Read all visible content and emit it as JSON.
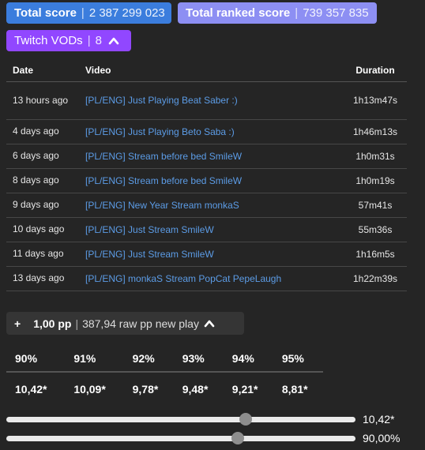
{
  "header": {
    "total_score_label": "Total score",
    "total_score_value": "2 387 299 023",
    "ranked_score_label": "Total ranked score",
    "ranked_score_value": "739 357 835",
    "score_color": "#3b7ddd",
    "ranked_color": "#8d8ff3"
  },
  "vods": {
    "toggle_label": "Twitch VODs",
    "count": "8",
    "accent_color": "#9147ff",
    "icon": "chevron-up-icon",
    "columns": {
      "date": "Date",
      "video": "Video",
      "duration": "Duration"
    },
    "rows": [
      {
        "date": "13 hours ago",
        "title": "[PL/ENG] Just Playing Beat Saber :)",
        "duration": "1h13m47s"
      },
      {
        "date": "4 days ago",
        "title": "[PL/ENG] Just Playing Beto Saba :)",
        "duration": "1h46m13s"
      },
      {
        "date": "6 days ago",
        "title": "[PL/ENG] Stream before bed SmileW",
        "duration": "1h0m31s"
      },
      {
        "date": "8 days ago",
        "title": "[PL/ENG] Stream before bed SmileW",
        "duration": "1h0m19s"
      },
      {
        "date": "9 days ago",
        "title": "[PL/ENG] New Year Stream monkaS",
        "duration": "57m41s"
      },
      {
        "date": "10 days ago",
        "title": "[PL/ENG] Just Stream SmileW",
        "duration": "55m36s"
      },
      {
        "date": "11 days ago",
        "title": "[PL/ENG] Just Stream SmileW",
        "duration": "1h16m5s"
      },
      {
        "date": "13 days ago",
        "title": "[PL/ENG] monkaS Stream PopCat PepeLaugh",
        "duration": "1h22m39s"
      }
    ]
  },
  "pp_calc": {
    "plus": "+",
    "pp_value": "1,00 pp",
    "raw_text": "387,94 raw pp new play",
    "icon": "chevron-up-icon",
    "accuracies": [
      "90%",
      "91%",
      "92%",
      "93%",
      "94%",
      "95%"
    ],
    "stars": [
      "10,42*",
      "10,09*",
      "9,78*",
      "9,48*",
      "9,21*",
      "8,81*"
    ]
  },
  "sliders": {
    "stars_value": "10,42*",
    "stars_fraction": 0.686,
    "acc_value": "90,00%",
    "acc_fraction": 0.662
  }
}
